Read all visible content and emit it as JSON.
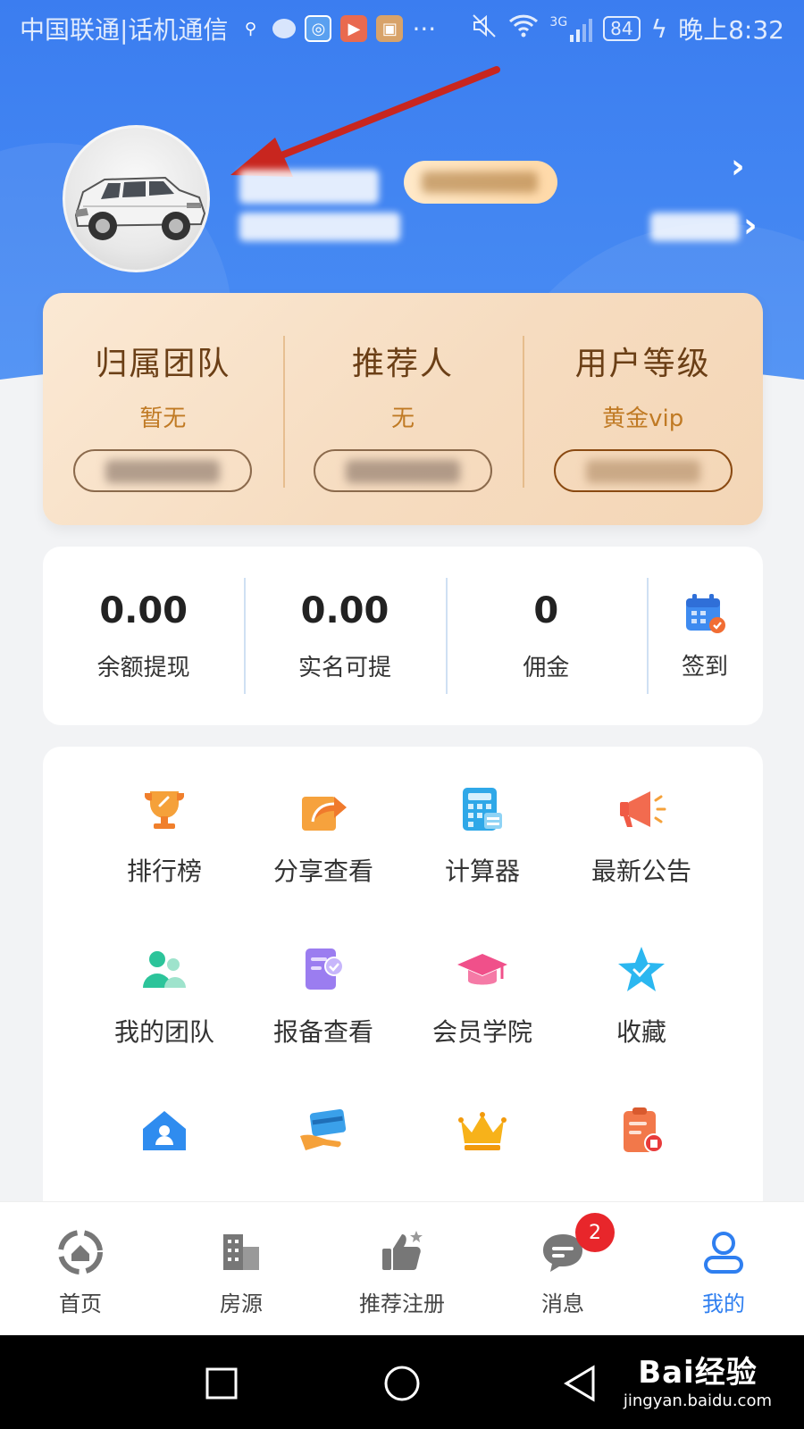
{
  "status_bar": {
    "carrier": "中国联通|话机通信",
    "battery": "84",
    "time": "晚上8:32",
    "more": "···",
    "network": "3G"
  },
  "vip_card": {
    "items": [
      {
        "title": "归属团队",
        "value": "暂无"
      },
      {
        "title": "推荐人",
        "value": "无"
      },
      {
        "title": "用户等级",
        "value": "黄金vip"
      }
    ]
  },
  "stats": {
    "balance_value": "0.00",
    "balance_label": "余额提现",
    "realname_value": "0.00",
    "realname_label": "实名可提",
    "commission_value": "0",
    "commission_label": "佣金",
    "signin_label": "签到"
  },
  "grid": {
    "items": [
      {
        "label": "排行榜",
        "icon": "trophy-icon"
      },
      {
        "label": "分享查看",
        "icon": "share-icon"
      },
      {
        "label": "计算器",
        "icon": "calculator-icon"
      },
      {
        "label": "最新公告",
        "icon": "megaphone-icon"
      },
      {
        "label": "我的团队",
        "icon": "team-icon"
      },
      {
        "label": "报备查看",
        "icon": "report-icon"
      },
      {
        "label": "会员学院",
        "icon": "graduation-cap-icon"
      },
      {
        "label": "收藏",
        "icon": "star-icon"
      },
      {
        "label": "",
        "icon": "house-user-icon"
      },
      {
        "label": "",
        "icon": "card-hand-icon"
      },
      {
        "label": "",
        "icon": "crown-icon"
      },
      {
        "label": "",
        "icon": "clipboard-icon"
      }
    ]
  },
  "tabbar": {
    "items": [
      {
        "label": "首页"
      },
      {
        "label": "房源"
      },
      {
        "label": "推荐注册"
      },
      {
        "label": "消息",
        "badge": "2"
      },
      {
        "label": "我的"
      }
    ]
  },
  "watermark": {
    "brand": "Bai经验",
    "url": "jingyan.baidu.com"
  },
  "colors": {
    "header_blue": "#3b7df0",
    "active_tab": "#2f7ff0",
    "badge_red": "#e8262b",
    "vip_title": "#6b3f16",
    "vip_value": "#c07a24"
  }
}
